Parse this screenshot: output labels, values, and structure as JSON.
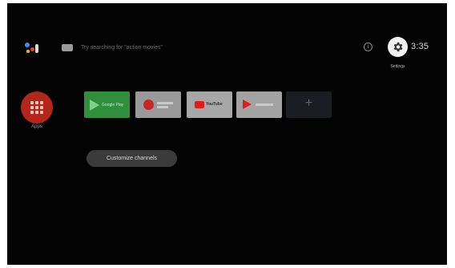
{
  "top_bar": {
    "search_hint": "Try searching for \"action movies\"",
    "info_icon_glyph": "i",
    "settings_label": "Settings",
    "clock": "3:35"
  },
  "apps": {
    "label": "Apps",
    "color": "#b4261c"
  },
  "favorites": [
    {
      "name": "Google Play Store",
      "label": "Google Play"
    },
    {
      "name": "Google Play Movies & TV",
      "label": ""
    },
    {
      "name": "YouTube",
      "label": "YouTube"
    },
    {
      "name": "YouTube Music",
      "label": ""
    },
    {
      "name": "Add app",
      "label": "+"
    }
  ],
  "customize_channels_label": "Customize channels"
}
